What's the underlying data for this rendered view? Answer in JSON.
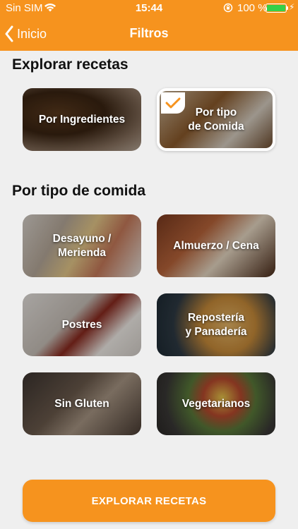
{
  "status_bar": {
    "carrier": "Sin SIM",
    "time": "15:44",
    "battery_percent": "100 %",
    "battery_level": 1.0,
    "battery_color": "#35d048",
    "icons": [
      "wifi-icon",
      "orientation-lock-icon",
      "battery-icon",
      "charging-bolt-icon"
    ]
  },
  "nav": {
    "back_label": "Inicio",
    "title": "Filtros"
  },
  "sections": {
    "explore_title": "Explorar recetas",
    "type_title": "Por tipo de comida"
  },
  "explore_cards": [
    {
      "label": "Por Ingredientes",
      "selected": false
    },
    {
      "label": "Por tipo\nde Comida",
      "selected": true
    }
  ],
  "type_cards": [
    {
      "label": "Desayuno /\nMerienda"
    },
    {
      "label": "Almuerzo / Cena"
    },
    {
      "label": "Postres"
    },
    {
      "label": "Repostería\ny Panadería"
    },
    {
      "label": "Sin Gluten"
    },
    {
      "label": "Vegetarianos"
    }
  ],
  "cta": {
    "label": "EXPLORAR RECETAS"
  },
  "colors": {
    "accent": "#f6931e",
    "background": "#efefef",
    "text": "#111111"
  }
}
